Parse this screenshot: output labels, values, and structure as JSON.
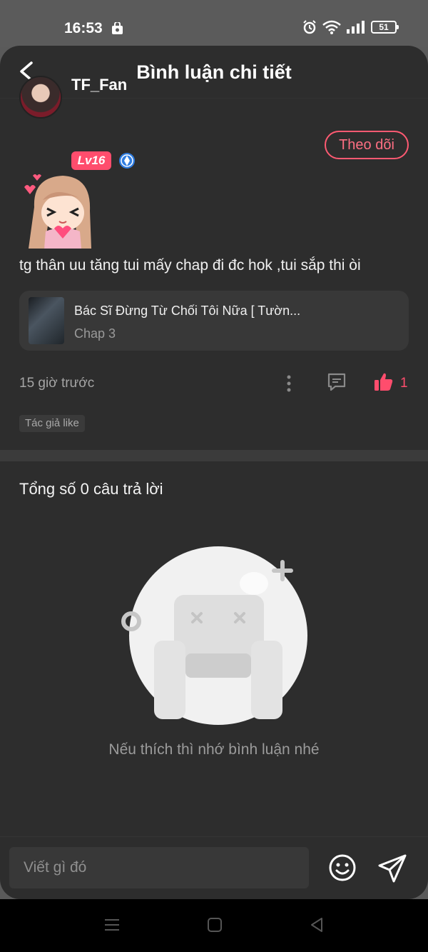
{
  "status_bar": {
    "time": "16:53",
    "battery": "51"
  },
  "header": {
    "title": "Bình luận chi tiết"
  },
  "comment": {
    "username": "TF_Fan",
    "level": "Lv16",
    "follow_label": "Theo dõi",
    "text": "tg thân uu tăng tui mấy chap đi đc hok ,tui sắp thi òi",
    "story": {
      "title": "Bác Sĩ Đừng Từ Chối Tôi Nữa [ Tườn...",
      "chapter": "Chap 3"
    },
    "time": "15 giờ trước",
    "likes": "1",
    "author_like_tag": "Tác giả like"
  },
  "replies": {
    "total_label": "Tổng số 0 câu trả lời",
    "empty_message": "Nếu thích thì nhớ bình luận nhé"
  },
  "input": {
    "placeholder": "Viết gì đó"
  },
  "colors": {
    "accent": "#ff4d6d",
    "background": "#2d2d2d",
    "card": "#383838"
  },
  "icons": [
    "back-arrow-icon",
    "shopping-bag-icon",
    "alarm-icon",
    "wifi-icon",
    "signal-icon",
    "verified-icon",
    "more-vertical-icon",
    "reply-icon",
    "thumbs-up-icon",
    "smiley-icon",
    "send-icon",
    "menu-icon",
    "home-square-icon",
    "back-triangle-icon"
  ]
}
